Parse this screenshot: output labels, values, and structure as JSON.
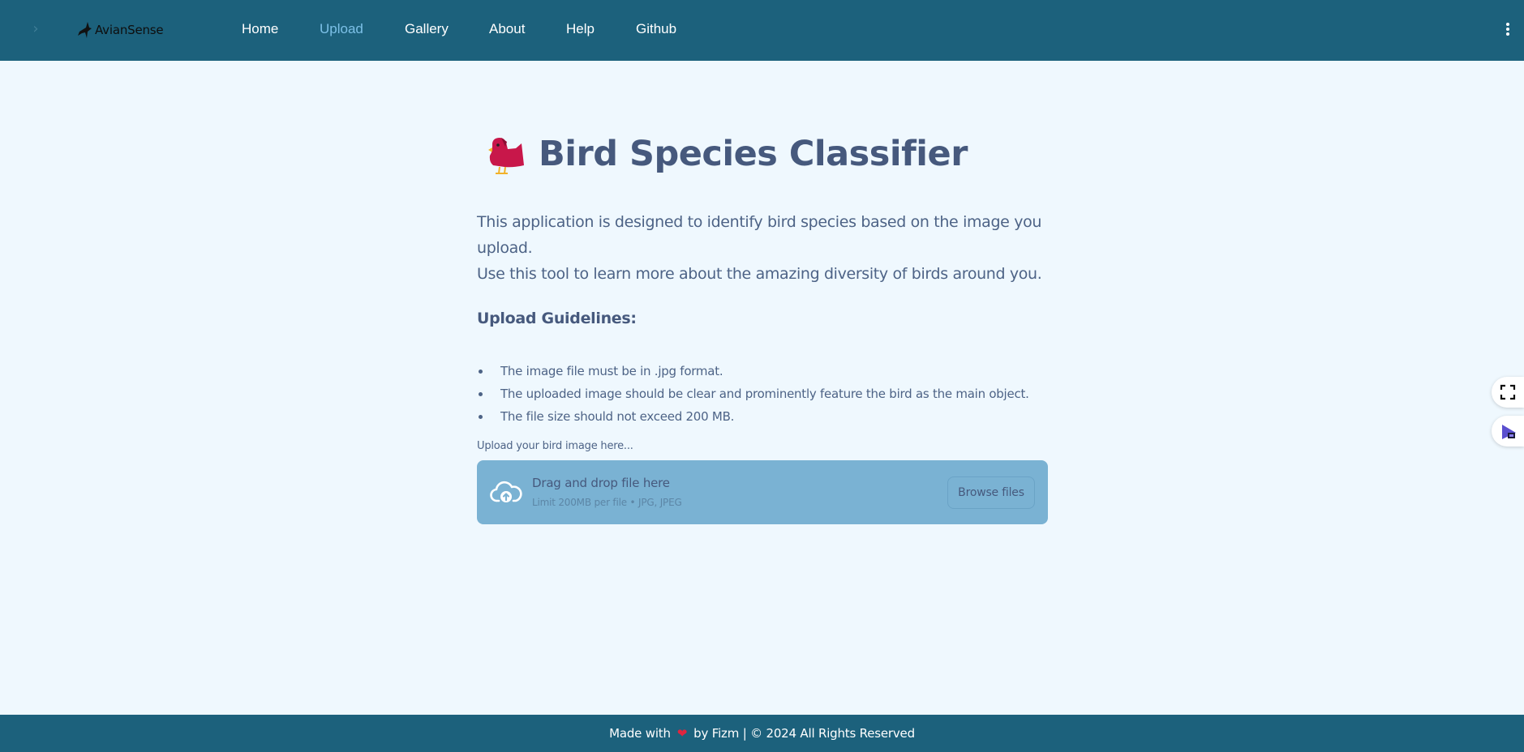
{
  "header": {
    "sidebar_toggle_icon": "chevron-right-icon",
    "logo_text": "AvianSense",
    "nav": [
      {
        "label": "Home",
        "active": false
      },
      {
        "label": "Upload",
        "active": true
      },
      {
        "label": "Gallery",
        "active": false
      },
      {
        "label": "About",
        "active": false
      },
      {
        "label": "Help",
        "active": false
      },
      {
        "label": "Github",
        "active": false
      }
    ],
    "menu_icon": "kebab-menu-icon",
    "background_color": "#1c617c",
    "active_color": "#7cc0e7"
  },
  "main": {
    "title_icon": "bird-emoji",
    "title": "Bird Species Classifier",
    "intro_line1": "This application is designed to identify bird species based on the image you upload.",
    "intro_line2": "Use this tool to learn more about the amazing diversity of birds around you.",
    "guidelines_title": "Upload Guidelines:",
    "guidelines": [
      "The image file must be in .jpg format.",
      "The uploaded image should be clear and prominently feature the bird as the main object.",
      "The file size should not exceed 200 MB."
    ]
  },
  "uploader": {
    "label": "Upload your bird image here...",
    "drop_title": "Drag and drop file here",
    "drop_limit": "Limit 200MB per file • JPG, JPEG",
    "browse_label": "Browse files",
    "icon": "cloud-upload-icon",
    "background_color": "#7ab2d3"
  },
  "floating": {
    "fullscreen_icon": "fullscreen-icon",
    "extension_icon": "extension-icon"
  },
  "footer": {
    "prefix": "Made with",
    "heart": "❤",
    "suffix": "by Fizm | © 2024 All Rights Reserved"
  }
}
